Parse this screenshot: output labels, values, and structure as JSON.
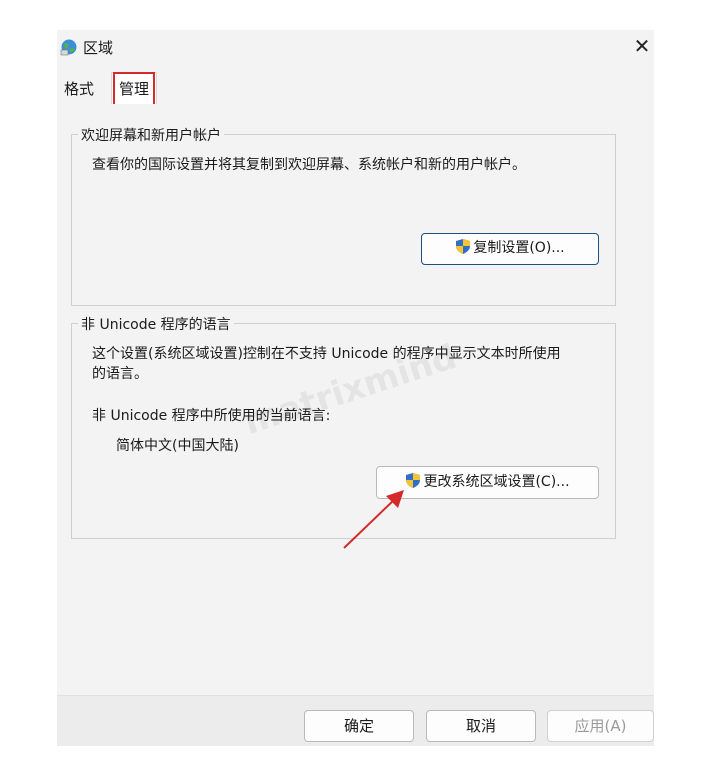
{
  "window": {
    "title": "区域",
    "close_glyph": "✕"
  },
  "tabs": [
    {
      "label": "格式"
    },
    {
      "label": "管理"
    }
  ],
  "welcome_group": {
    "legend": "欢迎屏幕和新用户帐户",
    "description": "查看你的国际设置并将其复制到欢迎屏幕、系统帐户和新的用户帐户。",
    "button": "复制设置(O)..."
  },
  "unicode_group": {
    "legend": "非 Unicode 程序的语言",
    "description_line1": "这个设置(系统区域设置)控制在不支持 Unicode 的程序中显示文本时所使用",
    "description_line2": "的语言。",
    "current_label": "非 Unicode 程序中所使用的当前语言:",
    "current_value": "简体中文(中国大陆)",
    "button": "更改系统区域设置(C)..."
  },
  "footer": {
    "ok": "确定",
    "cancel": "取消",
    "apply": "应用(A)"
  },
  "watermark": "matrixmind",
  "colors": {
    "highlight": "#d32b2b",
    "accent": "#1b4f86",
    "window_bg": "#f3f3f3"
  },
  "icons": {
    "title": "region-globe-icon",
    "button": "uac-shield-icon",
    "annotation": "red-arrow"
  }
}
